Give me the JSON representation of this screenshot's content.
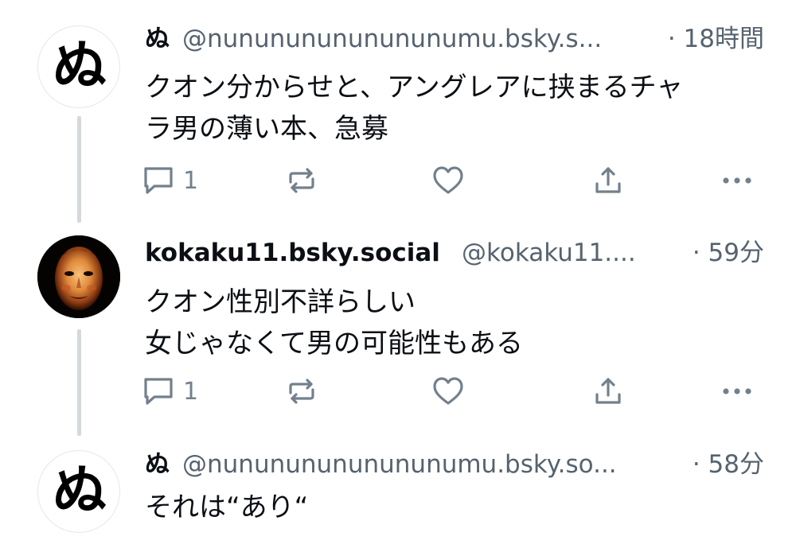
{
  "posts": [
    {
      "avatar": {
        "text": "ぬ"
      },
      "display_name": "ぬ",
      "handle": "@nunununununununumu.bsky.s...",
      "time": "· 18時間",
      "text_lines": [
        "クオン分からせと、アングレアに挟まるチャ",
        "ラ男の薄い本、急募"
      ],
      "reply_count": "1"
    },
    {
      "avatar": {
        "text": ""
      },
      "display_name": "kokaku11.bsky.social",
      "handle": "@kokaku11....",
      "time": "· 59分",
      "text_lines": [
        "クオン性別不詳らしい",
        "女じゃなくて男の可能性もある"
      ],
      "reply_count": "1"
    },
    {
      "avatar": {
        "text": "ぬ"
      },
      "display_name": "ぬ",
      "handle": "@nunununununununumu.bsky.so...",
      "time": "· 58分",
      "text_lines": [
        "それは“あり“"
      ]
    }
  ],
  "colors": {
    "text": "#0b0f14",
    "muted": "#56636f",
    "icon": "#73808c",
    "thread_line": "#d4d9de"
  },
  "icons": [
    "reply-icon",
    "repost-icon",
    "like-icon",
    "share-icon",
    "more-icon"
  ]
}
